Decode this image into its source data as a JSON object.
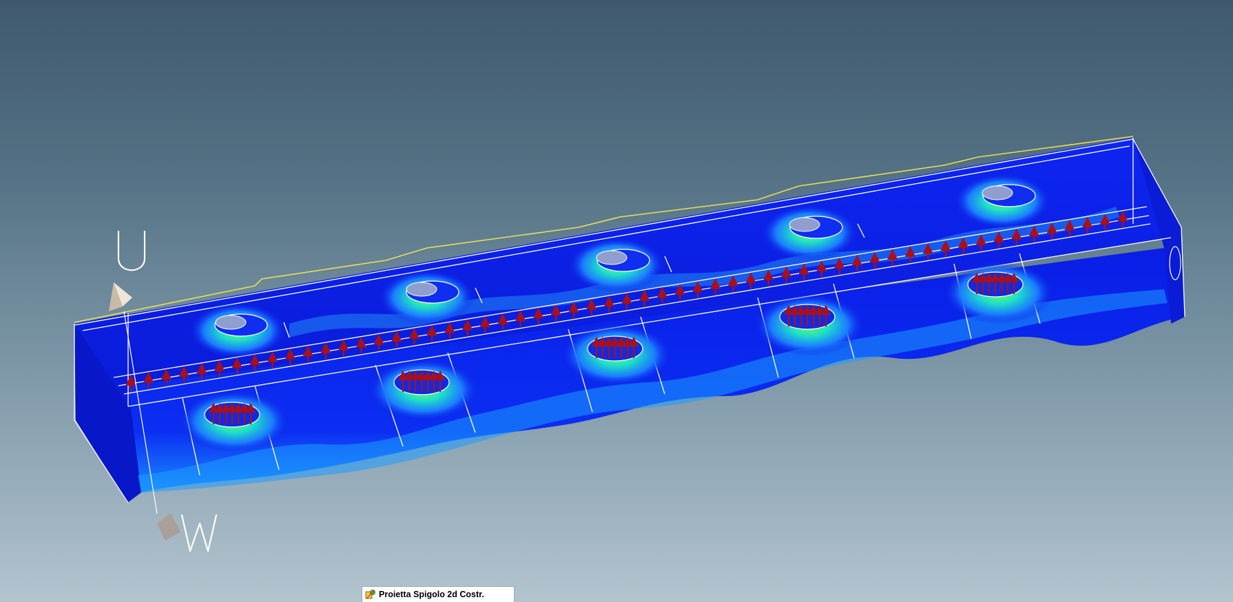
{
  "viewport": {
    "background_top": "#3f586d",
    "background_bottom": "#b3c4cf"
  },
  "model": {
    "mesh_color": "#0a1fe8",
    "highlight_color": "#1fa3ff",
    "edge_color": "#ffffff",
    "outline_color": "#e8e05a",
    "load_arrow_color": "#a8101a"
  },
  "triad": {
    "up_label": "U",
    "depth_label": "W"
  },
  "status_tab": {
    "icon": "project-edge-tool-icon",
    "label": "Proietta Spigolo 2d Costr."
  }
}
